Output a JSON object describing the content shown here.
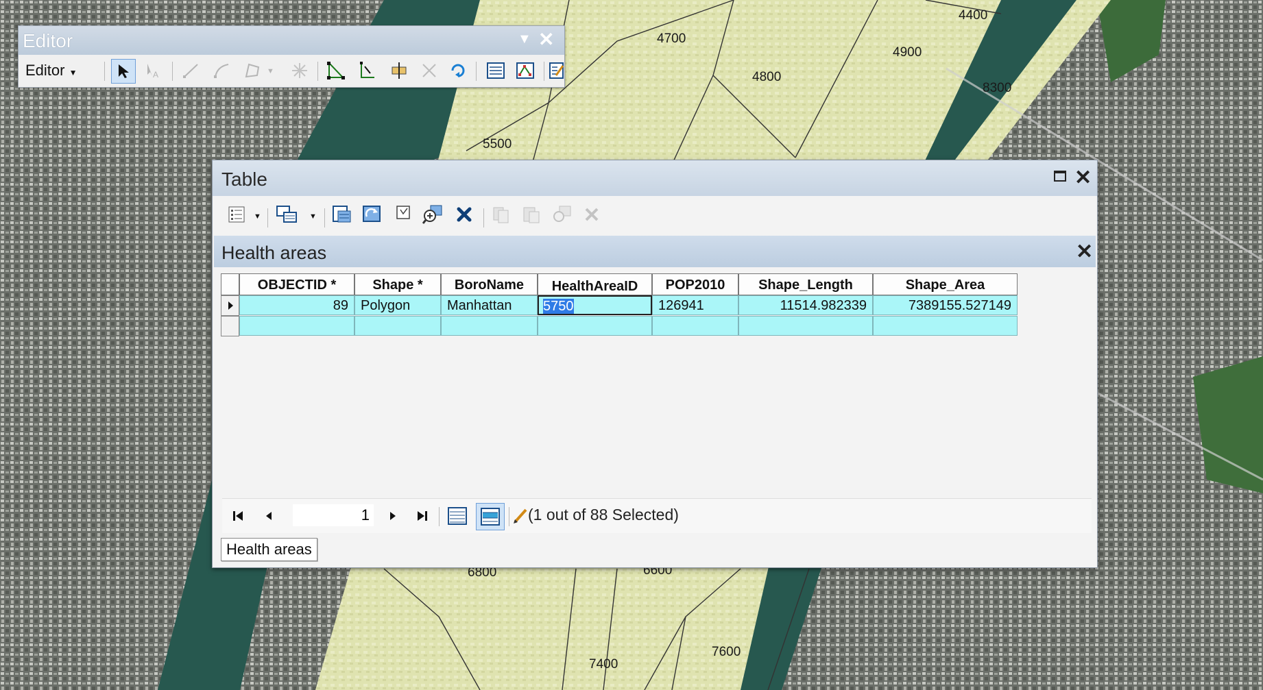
{
  "map": {
    "labels": [
      "4400",
      "4700",
      "4900",
      "4800",
      "8300",
      "5500",
      "6800",
      "6600",
      "7600",
      "7400"
    ]
  },
  "editor": {
    "title": "Editor",
    "menu_label": "Editor",
    "tools": [
      "select-arrow",
      "edit-annotation",
      "straight-segment",
      "curve-segment",
      "construction-tools",
      "snap",
      "edit-vertices",
      "reshape",
      "cut-polygons",
      "split",
      "rotate",
      "attributes",
      "sketch-properties",
      "create-features"
    ]
  },
  "table": {
    "title": "Table",
    "tab_title": "Health areas",
    "columns": [
      "OBJECTID *",
      "Shape *",
      "BoroName",
      "HealthAreaID",
      "POP2010",
      "Shape_Length",
      "Shape_Area"
    ],
    "rows": [
      [
        "89",
        "Polygon",
        "Manhattan",
        "5750",
        "126941",
        "11514.982339",
        "7389155.527149"
      ]
    ],
    "page_value": "1",
    "status": "(1 out of 88 Selected)",
    "bottom_tab": "Health areas"
  },
  "colors": {
    "selected_row": "#aaf6f8",
    "highlight": "#2f7be6",
    "water": "#27584f",
    "health_area_fill": "#dfe3b0"
  }
}
